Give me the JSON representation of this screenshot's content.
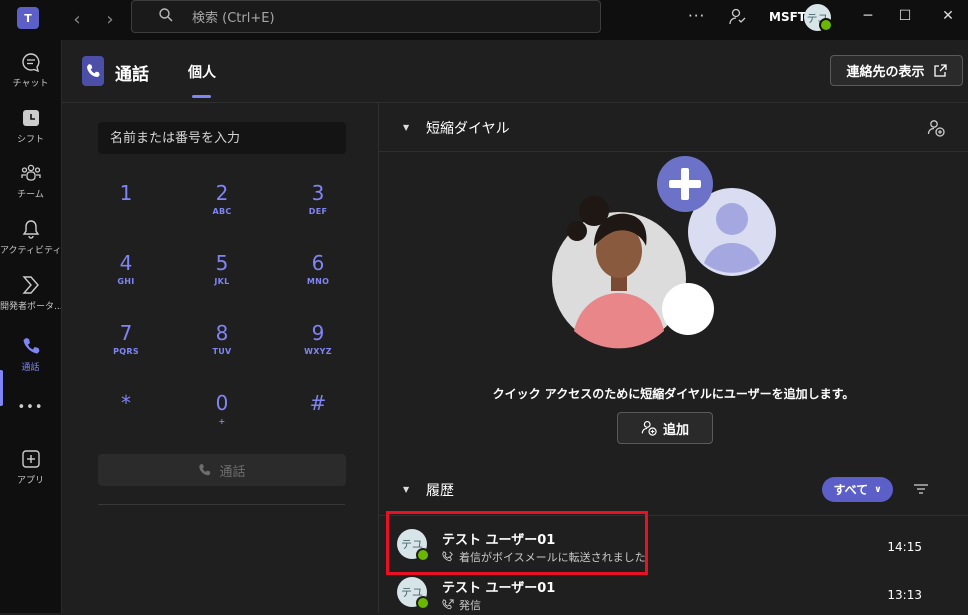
{
  "titlebar": {
    "search_placeholder": "検索 (Ctrl+E)",
    "more": "···",
    "org": "MSFT",
    "avatar_initials": "テユ",
    "icons": [
      "teams-logo-icon",
      "back-icon",
      "forward-icon",
      "search-icon",
      "people-icon",
      "minimize-icon",
      "maximize-icon",
      "close-icon"
    ]
  },
  "rail": {
    "items": [
      {
        "label": "チャット",
        "icon": "chat-icon"
      },
      {
        "label": "シフト",
        "icon": "shifts-icon"
      },
      {
        "label": "チーム",
        "icon": "teams-icon"
      },
      {
        "label": "アクティビティ",
        "icon": "bell-icon"
      },
      {
        "label": "開発者ポータ...",
        "icon": "dev-portal-icon"
      },
      {
        "label": "通話",
        "icon": "phone-icon",
        "active": true
      },
      {
        "label": "アプリ",
        "icon": "add-apps-icon"
      }
    ],
    "more": "•••",
    "accent": "#7f85f5"
  },
  "header": {
    "title": "通話",
    "tab": "個人",
    "contacts_button": "連絡先の表示"
  },
  "dialpad": {
    "placeholder": "名前または番号を入力",
    "keys": [
      {
        "digit": "1",
        "letters": ""
      },
      {
        "digit": "2",
        "letters": "ABC"
      },
      {
        "digit": "3",
        "letters": "DEF"
      },
      {
        "digit": "4",
        "letters": "GHI"
      },
      {
        "digit": "5",
        "letters": "JKL"
      },
      {
        "digit": "6",
        "letters": "MNO"
      },
      {
        "digit": "7",
        "letters": "PQRS"
      },
      {
        "digit": "8",
        "letters": "TUV"
      },
      {
        "digit": "9",
        "letters": "WXYZ"
      },
      {
        "digit": "*",
        "letters": ""
      },
      {
        "digit": "0",
        "letters": "+"
      },
      {
        "digit": "#",
        "letters": ""
      }
    ],
    "call_button": "通話"
  },
  "speed_dial": {
    "title": "短縮ダイヤル",
    "message": "クイック アクセスのために短縮ダイヤルにユーザーを追加します。",
    "add_button": "追加"
  },
  "history": {
    "title": "履歴",
    "filter": "すべて",
    "rows": [
      {
        "name": "テスト ユーザー01",
        "detail": "着信がボイスメールに転送されました",
        "time": "14:15",
        "avatar": "テユ"
      },
      {
        "name": "テスト ユーザー01",
        "detail": "発信",
        "time": "13:13",
        "avatar": "テユ"
      }
    ]
  },
  "colors": {
    "accent": "#7f85f5",
    "brand": "#5b5fc7",
    "available": "#6bb700",
    "highlight": "#e81123"
  }
}
